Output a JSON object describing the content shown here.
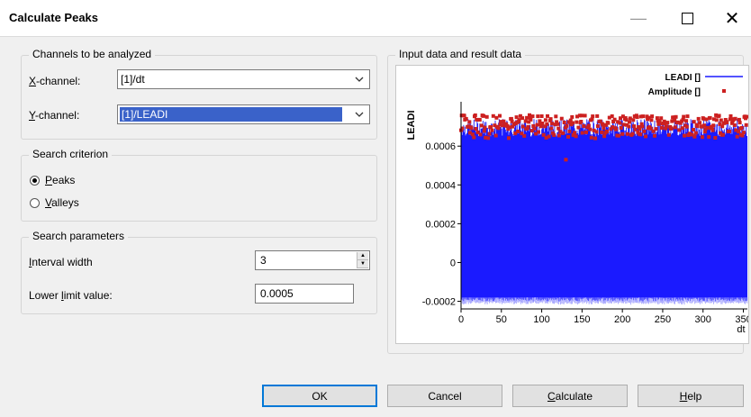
{
  "window": {
    "title": "Calculate Peaks",
    "min_glyph": "—",
    "close_glyph": "✕"
  },
  "channels": {
    "group_title": "Channels to be analyzed",
    "x_label_ul": "X",
    "x_label_rest": "-channel:",
    "x_value": "[1]/dt",
    "y_label_ul": "Y",
    "y_label_rest": "-channel:",
    "y_value": "[1]/LEADI"
  },
  "search_criterion": {
    "group_title": "Search criterion",
    "peaks_ul": "P",
    "peaks_rest": "eaks",
    "valleys_ul": "V",
    "valleys_rest": "alleys",
    "selected": "Peaks"
  },
  "search_params": {
    "group_title": "Search parameters",
    "interval_ul": "I",
    "interval_rest": "nterval width",
    "interval_value": "3",
    "lower_pre": "Lower ",
    "lower_ul": "l",
    "lower_rest": "imit value:",
    "lower_value": "0.0005"
  },
  "result": {
    "group_title": "Input data and result data"
  },
  "buttons": {
    "ok": "OK",
    "cancel": "Cancel",
    "calculate_ul": "C",
    "calculate_rest": "alculate",
    "help_ul": "H",
    "help_rest": "elp"
  },
  "chart_data": {
    "type": "scatter",
    "ylabel": "LEADI",
    "xlabel": "dt",
    "x_ticks": [
      "0",
      "50",
      "100",
      "150",
      "200",
      "250",
      "300",
      "350"
    ],
    "y_ticks": [
      "0.0006",
      "0.0004",
      "0.0002",
      "0",
      "-0.0002"
    ],
    "xlim": [
      0,
      355
    ],
    "ylim": [
      -0.00023,
      0.00081
    ],
    "series": [
      {
        "name": "LEADI []",
        "style": "line",
        "color": "#1a1aff",
        "summary": {
          "upper_band": [
            0.00065,
            0.00074
          ],
          "lower_band": [
            -0.0002,
            -0.00018
          ]
        }
      },
      {
        "name": "Amplitude []",
        "style": "points",
        "color": "#cc2020",
        "y_range": [
          0.00064,
          0.00076
        ],
        "outlier": {
          "x": 130,
          "y": 0.00053
        }
      }
    ],
    "colors": {
      "line": "#1a1aff",
      "points": "#cc2020"
    }
  }
}
